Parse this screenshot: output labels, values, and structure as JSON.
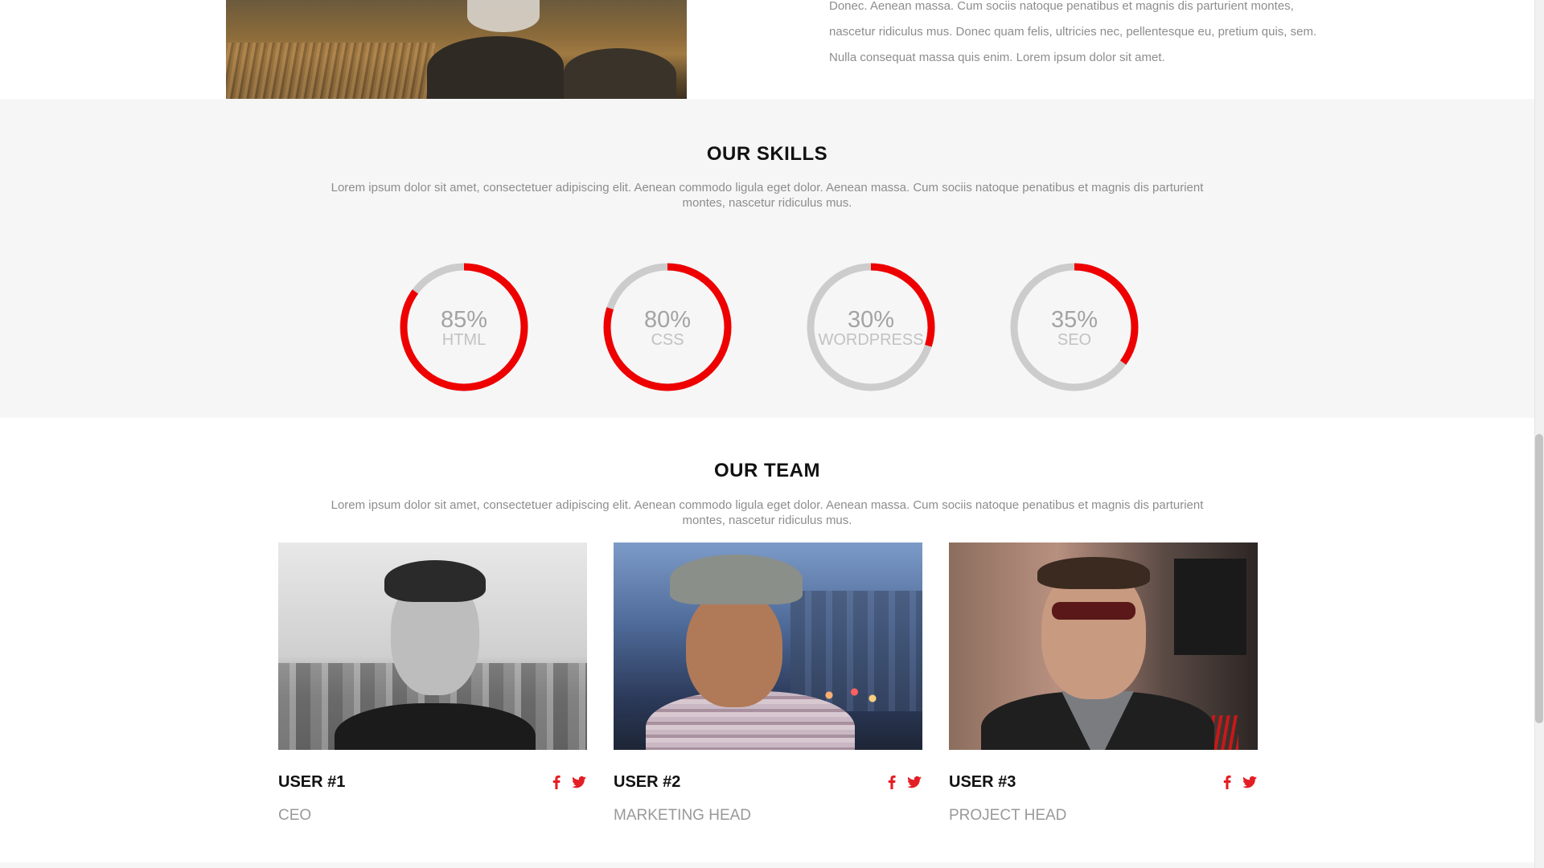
{
  "about": {
    "text_lines": [
      "Donec. Aenean massa. Cum sociis natoque penatibus et magnis dis parturient montes,",
      "nascetur ridiculus mus. Donec quam felis, ultricies nec, pellentesque eu, pretium quis, sem.",
      "Nulla consequat massa quis enim. Lorem ipsum dolor sit amet."
    ]
  },
  "skills": {
    "title": "OUR SKILLS",
    "description": "Lorem ipsum dolor sit amet, consectetuer adipiscing elit. Aenean commodo ligula eget dolor. Aenean massa. Cum sociis natoque penatibus et magnis dis parturient montes, nascetur ridiculus mus.",
    "items": [
      {
        "percent_text": "85%",
        "name": "HTML",
        "value": 85
      },
      {
        "percent_text": "80%",
        "name": "CSS",
        "value": 80
      },
      {
        "percent_text": "30%",
        "name": "WORDPRESS",
        "value": 30
      },
      {
        "percent_text": "35%",
        "name": "SEO",
        "value": 35
      }
    ],
    "colors": {
      "progress": "#ee0000",
      "track": "#cccccc"
    }
  },
  "team": {
    "title": "OUR TEAM",
    "description": "Lorem ipsum dolor sit amet, consectetuer adipiscing elit. Aenean commodo ligula eget dolor. Aenean massa. Cum sociis natoque penatibus et magnis dis parturient montes, nascetur ridiculus mus.",
    "members": [
      {
        "name": "USER #1",
        "role": "CEO",
        "icons": [
          "facebook-icon",
          "twitter-icon"
        ]
      },
      {
        "name": "USER #2",
        "role": "MARKETING HEAD",
        "icons": [
          "facebook-icon",
          "twitter-icon"
        ]
      },
      {
        "name": "USER #3",
        "role": "PROJECT HEAD",
        "icons": [
          "facebook-icon",
          "twitter-icon"
        ]
      }
    ],
    "icon_color": "#e31e24"
  }
}
